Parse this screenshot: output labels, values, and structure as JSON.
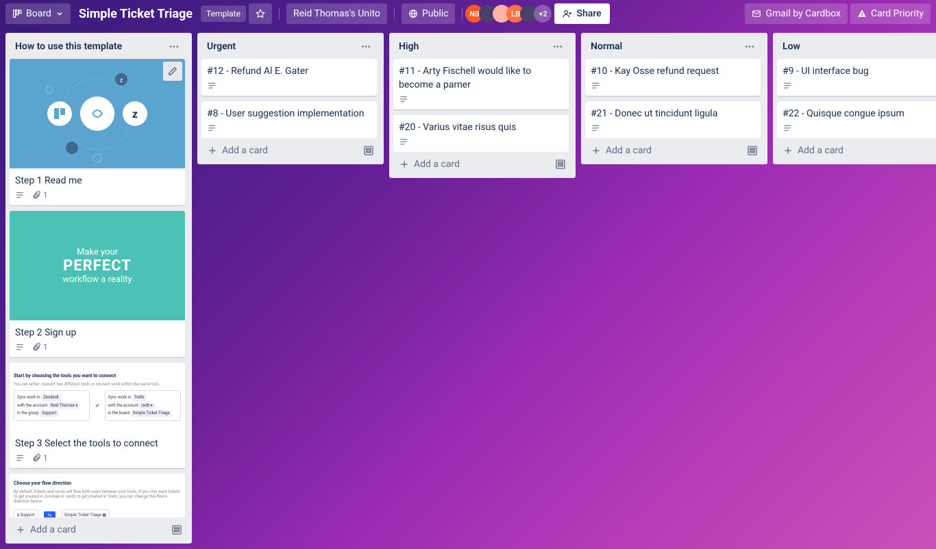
{
  "topbar": {
    "board_view_label": "Board",
    "board_title": "Simple Ticket Triage",
    "template_badge": "Template",
    "workspace_label": "Reid Thomas's Unito",
    "visibility_label": "Public",
    "avatar_overflow": "+2",
    "share_label": "Share",
    "gmail_button": "Gmail by Cardbox",
    "card_priority_button": "Card Priority"
  },
  "add_card_label": "Add a card",
  "lists": [
    {
      "title": "How to use this template",
      "cards": [
        {
          "title": "Step 1 Read me",
          "cover": "blue",
          "attachment_count": "1",
          "has_desc": true,
          "has_edit": true
        },
        {
          "title": "Step 2 Sign up",
          "cover": "teal",
          "attachment_count": "1",
          "has_desc": true,
          "cover_text_top": "Make your",
          "cover_text_big": "PERFECT",
          "cover_text_bottom": "workflow a reality"
        },
        {
          "title": "Step 3 Select the tools to connect",
          "cover": "shot1",
          "attachment_count": "1",
          "has_desc": true
        },
        {
          "title": "",
          "cover": "shot2"
        }
      ]
    },
    {
      "title": "Urgent",
      "cards": [
        {
          "title": "#12 - Refund Al E. Gater",
          "has_desc": true
        },
        {
          "title": "#8 - User suggestion implementation",
          "has_desc": true
        }
      ]
    },
    {
      "title": "High",
      "cards": [
        {
          "title": "#11 - Arty Fischell would like to become a parner",
          "has_desc": true
        },
        {
          "title": "#20 - Varius vitae risus quis",
          "has_desc": true
        }
      ]
    },
    {
      "title": "Normal",
      "cards": [
        {
          "title": "#10 - Kay Osse refund request",
          "has_desc": true
        },
        {
          "title": "#21 - Donec ut tincidunt ligula",
          "has_desc": true
        }
      ]
    },
    {
      "title": "Low",
      "cards": [
        {
          "title": "#9 - UI interface bug",
          "has_desc": true
        },
        {
          "title": "#22 - Quisque congue ipsum",
          "has_desc": true
        }
      ]
    }
  ]
}
